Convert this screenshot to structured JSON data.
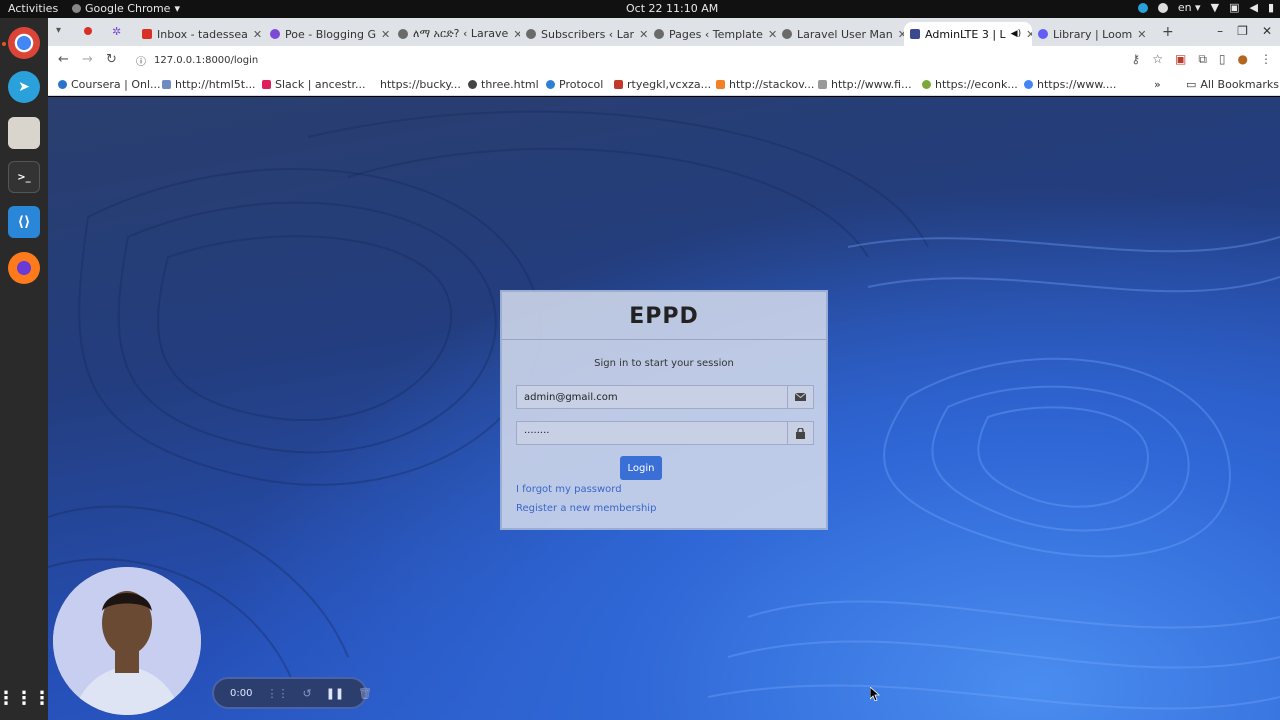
{
  "system": {
    "activities": "Activities",
    "app_name": "Google Chrome",
    "clock": "Oct 22  11:10 AM",
    "language": "en"
  },
  "browser": {
    "tabs": [
      {
        "label": "Inbox - tadessea",
        "color": "#d93025"
      },
      {
        "label": "Poe - Blogging G",
        "color": "#7b4bd6"
      },
      {
        "label": "ለማ አርድ? ‹ Larave",
        "color": "#6a6a6a"
      },
      {
        "label": "Subscribers ‹ Lar",
        "color": "#6a6a6a"
      },
      {
        "label": "Pages ‹ Template",
        "color": "#6a6a6a"
      },
      {
        "label": "Laravel User Man",
        "color": "#6a6a6a"
      },
      {
        "label": "AdminLTE 3 | L",
        "color": "#3b4a8f",
        "active": true
      },
      {
        "label": "Library | Loom",
        "color": "#625df5"
      }
    ],
    "url": "127.0.0.1:8000/login",
    "bookmarks": [
      {
        "label": "Coursera | Onl...",
        "color": "#2a73cc"
      },
      {
        "label": "http://html5t...",
        "color": "#6e8bc2"
      },
      {
        "label": "Slack | ancestr...",
        "color": "#e01e5a"
      },
      {
        "label": "https://bucky...",
        "color": "#ffffff"
      },
      {
        "label": "three.html",
        "color": "#444444"
      },
      {
        "label": "Protocol",
        "color": "#2d7fd3"
      },
      {
        "label": "rtyegkl,vcxza...",
        "color": "#c0392b"
      },
      {
        "label": "http://stackov...",
        "color": "#f48024"
      },
      {
        "label": "http://www.fi...",
        "color": "#999999"
      },
      {
        "label": "https://econk...",
        "color": "#7aa83a"
      },
      {
        "label": "https://www....",
        "color": "#4285f4"
      }
    ],
    "all_bookmarks": "All Bookmarks"
  },
  "login": {
    "brand": "EPPD",
    "message": "Sign in to start your session",
    "email_value": "admin@gmail.com",
    "password_value": "········",
    "button": "Login",
    "forgot": "I forgot my password",
    "register": "Register a new membership",
    "accent": "#3a6fd6"
  },
  "loom": {
    "timer": "0:00"
  }
}
